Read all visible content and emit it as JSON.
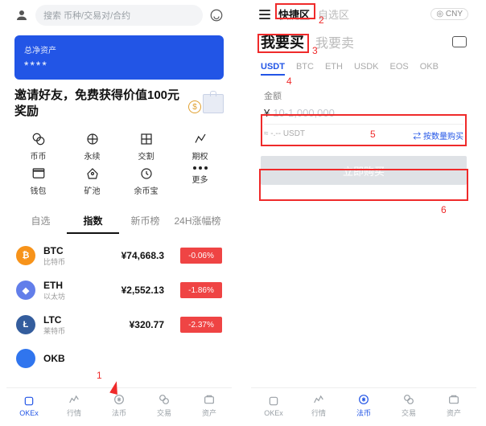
{
  "left": {
    "search_placeholder": "搜索 币种/交易对/合约",
    "banner_title": "总净资产",
    "banner_value": "****",
    "invite_line": "邀请好友，免费获得价值100元奖励",
    "grid": [
      "币币",
      "永续",
      "交割",
      "期权",
      "钱包",
      "矿池",
      "余币宝",
      "更多"
    ],
    "tabs": [
      "自选",
      "指数",
      "新币榜",
      "24H涨幅榜"
    ],
    "active_tab": 1,
    "coins": [
      {
        "sym": "BTC",
        "sub": "比特币",
        "price": "¥74,668.3",
        "chg": "-0.06%"
      },
      {
        "sym": "ETH",
        "sub": "以太坊",
        "price": "¥2,552.13",
        "chg": "-1.86%"
      },
      {
        "sym": "LTC",
        "sub": "莱特币",
        "price": "¥320.77",
        "chg": "-2.37%"
      },
      {
        "sym": "OKB",
        "sub": "",
        "price": "",
        "chg": ""
      }
    ],
    "nav": [
      "OKEx",
      "行情",
      "法币",
      "交易",
      "资产"
    ]
  },
  "right": {
    "zones": [
      "快捷区",
      "自选区"
    ],
    "currency": "CNY",
    "buy_tabs": [
      "我要买",
      "我要卖"
    ],
    "coin_tabs": [
      "USDT",
      "BTC",
      "ETH",
      "USDK",
      "EOS",
      "OKB"
    ],
    "amount_label": "金额",
    "amount_placeholder": "10-1,000,000",
    "estimate": "≈ -.-- USDT",
    "by_qty": "⇄ 按数量购买",
    "buy_btn": "立即购买",
    "nav": [
      "OKEx",
      "行情",
      "法币",
      "交易",
      "资产"
    ],
    "nav_active": 2
  },
  "annotations": {
    "a1": "1",
    "a2": "2",
    "a3": "3",
    "a4": "4",
    "a5": "5",
    "a6": "6"
  }
}
